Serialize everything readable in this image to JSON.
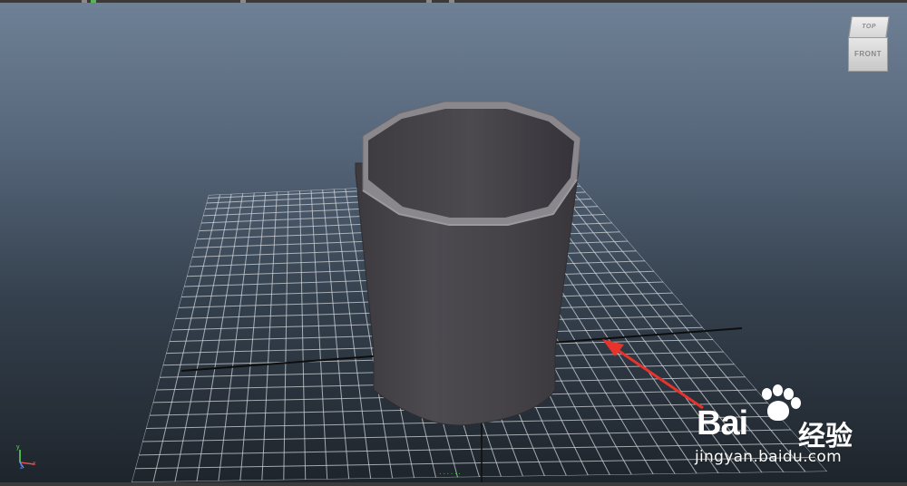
{
  "viewport": {
    "view_cube": {
      "top_label": "TOP",
      "front_label": "FRONT"
    },
    "axes": {
      "x": "x",
      "y": "y",
      "z": "z"
    },
    "hud_bottom_text": "......",
    "objects": [
      {
        "name": "cylinder",
        "type": "open-cylinder",
        "color": "#48464a"
      }
    ],
    "grid": {
      "visible": true,
      "color": "#d0d4d8"
    },
    "annotation": {
      "type": "arrow",
      "color": "#e8322c"
    }
  },
  "watermark": {
    "brand": "Bai",
    "brand_cn": "经验",
    "url": "jingyan.baidu.com"
  },
  "colors": {
    "background_top": "#6f8196",
    "background_bottom": "#1e242b",
    "arrow": "#e8322c"
  }
}
